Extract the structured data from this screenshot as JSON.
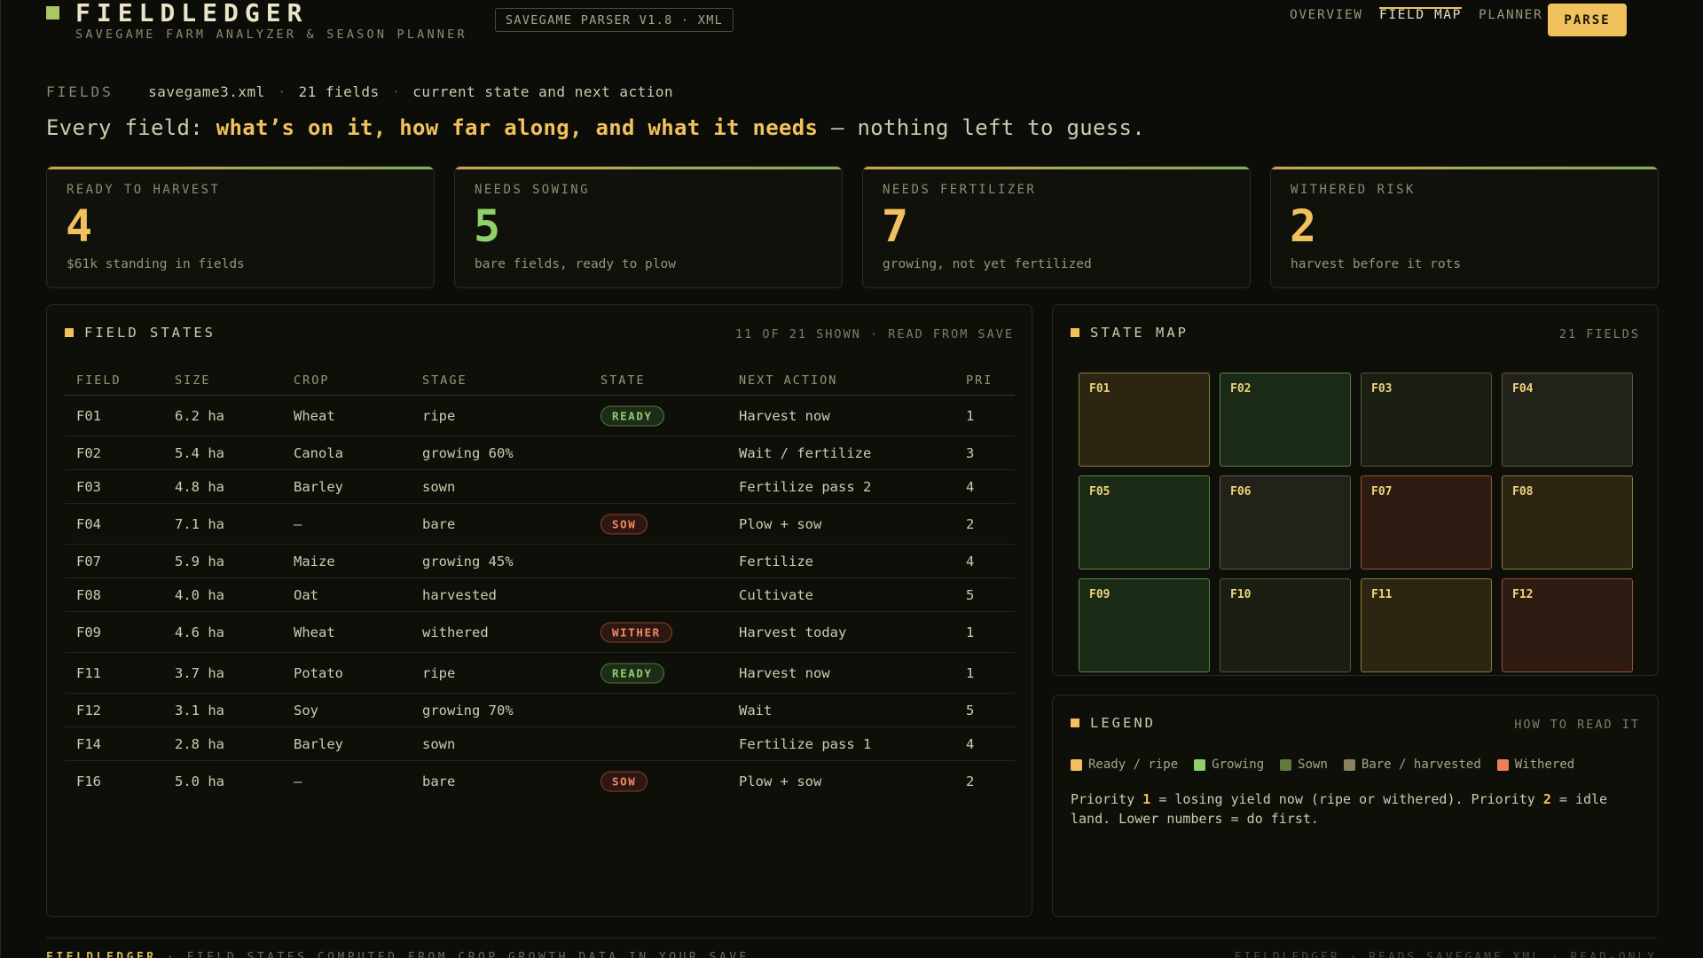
{
  "header": {
    "brand": "FIELDLEDGER",
    "subtitle": "SAVEGAME FARM ANALYZER & SEASON PLANNER",
    "version": "SAVEGAME PARSER V1.8 · XML",
    "nav": [
      "OVERVIEW",
      "FIELD MAP",
      "PLANNER"
    ],
    "active_nav": "FIELD MAP",
    "parse_label": "PARSE"
  },
  "meta": {
    "label": "FIELDS",
    "file": "savegame3.xml",
    "count": "21 fields",
    "note": "current state and next action"
  },
  "headline": {
    "lead": "Every field: ",
    "emphasis": "what’s on it, how far along, and what it needs",
    "tail": " — nothing left to guess."
  },
  "stats": [
    {
      "label": "READY TO HARVEST",
      "value": "4",
      "sub": "$61k standing in fields"
    },
    {
      "label": "NEEDS SOWING",
      "value": "5",
      "sub": "bare fields, ready to plow"
    },
    {
      "label": "NEEDS FERTILIZER",
      "value": "7",
      "sub": "growing, not yet fertilized"
    },
    {
      "label": "WITHERED RISK",
      "value": "2",
      "sub": "harvest before it rots"
    }
  ],
  "field_states": {
    "title": "FIELD STATES",
    "meta": "11 OF 21 SHOWN · READ FROM SAVE",
    "columns": [
      "FIELD",
      "SIZE",
      "CROP",
      "STAGE",
      "STATE",
      "NEXT ACTION",
      "PRI"
    ],
    "rows": [
      {
        "field": "F01",
        "size": "6.2 ha",
        "crop": "Wheat",
        "stage": "ripe",
        "state": "READY",
        "action": "Harvest now",
        "pri": "1"
      },
      {
        "field": "F02",
        "size": "5.4 ha",
        "crop": "Canola",
        "stage": "growing 60%",
        "state": "",
        "action": "Wait / fertilize",
        "pri": "3"
      },
      {
        "field": "F03",
        "size": "4.8 ha",
        "crop": "Barley",
        "stage": "sown",
        "state": "",
        "action": "Fertilize pass 2",
        "pri": "4"
      },
      {
        "field": "F04",
        "size": "7.1 ha",
        "crop": "—",
        "stage": "bare",
        "state": "SOW",
        "action": "Plow + sow",
        "pri": "2"
      },
      {
        "field": "F07",
        "size": "5.9 ha",
        "crop": "Maize",
        "stage": "growing 45%",
        "state": "",
        "action": "Fertilize",
        "pri": "4"
      },
      {
        "field": "F08",
        "size": "4.0 ha",
        "crop": "Oat",
        "stage": "harvested",
        "state": "",
        "action": "Cultivate",
        "pri": "5"
      },
      {
        "field": "F09",
        "size": "4.6 ha",
        "crop": "Wheat",
        "stage": "withered",
        "state": "WITHER",
        "action": "Harvest today",
        "pri": "1"
      },
      {
        "field": "F11",
        "size": "3.7 ha",
        "crop": "Potato",
        "stage": "ripe",
        "state": "READY",
        "action": "Harvest now",
        "pri": "1"
      },
      {
        "field": "F12",
        "size": "3.1 ha",
        "crop": "Soy",
        "stage": "growing 70%",
        "state": "",
        "action": "Wait",
        "pri": "5"
      },
      {
        "field": "F14",
        "size": "2.8 ha",
        "crop": "Barley",
        "stage": "sown",
        "state": "",
        "action": "Fertilize pass 1",
        "pri": "4"
      },
      {
        "field": "F16",
        "size": "5.0 ha",
        "crop": "—",
        "stage": "bare",
        "state": "SOW",
        "action": "Plow + sow",
        "pri": "2"
      }
    ]
  },
  "state_map": {
    "title": "STATE MAP",
    "meta": "21 FIELDS",
    "tiles": [
      {
        "id": "F01",
        "state": "ripe"
      },
      {
        "id": "F02",
        "state": "grow"
      },
      {
        "id": "F03",
        "state": "sown"
      },
      {
        "id": "F04",
        "state": "bare"
      },
      {
        "id": "F05",
        "state": "grow"
      },
      {
        "id": "F06",
        "state": "bare"
      },
      {
        "id": "F07",
        "state": "wither"
      },
      {
        "id": "F08",
        "state": "ripe"
      },
      {
        "id": "F09",
        "state": "grow"
      },
      {
        "id": "F10",
        "state": "sown"
      },
      {
        "id": "F11",
        "state": "ripe"
      },
      {
        "id": "F12",
        "state": "wither"
      }
    ]
  },
  "legend": {
    "title": "LEGEND",
    "meta": "HOW TO READ IT",
    "items": [
      {
        "label": "Ready / ripe",
        "color": "#f0c15c"
      },
      {
        "label": "Growing",
        "color": "#8fd068"
      },
      {
        "label": "Sown",
        "color": "#5e7a40"
      },
      {
        "label": "Bare / harvested",
        "color": "#8a8262"
      },
      {
        "label": "Withered",
        "color": "#ef7f5a"
      }
    ],
    "note_parts": [
      "Priority ",
      "1",
      " = losing yield now (ripe or withered). Priority ",
      "2",
      " = idle land. Lower numbers = do first."
    ]
  },
  "footer": {
    "brand": "FIELDLEDGER",
    "left": " · FIELD STATES COMPUTED FROM CROP GROWTH DATA IN YOUR SAVE",
    "right": "FIELDLEDGER · READS SAVEGAME XML · READ-ONLY"
  }
}
